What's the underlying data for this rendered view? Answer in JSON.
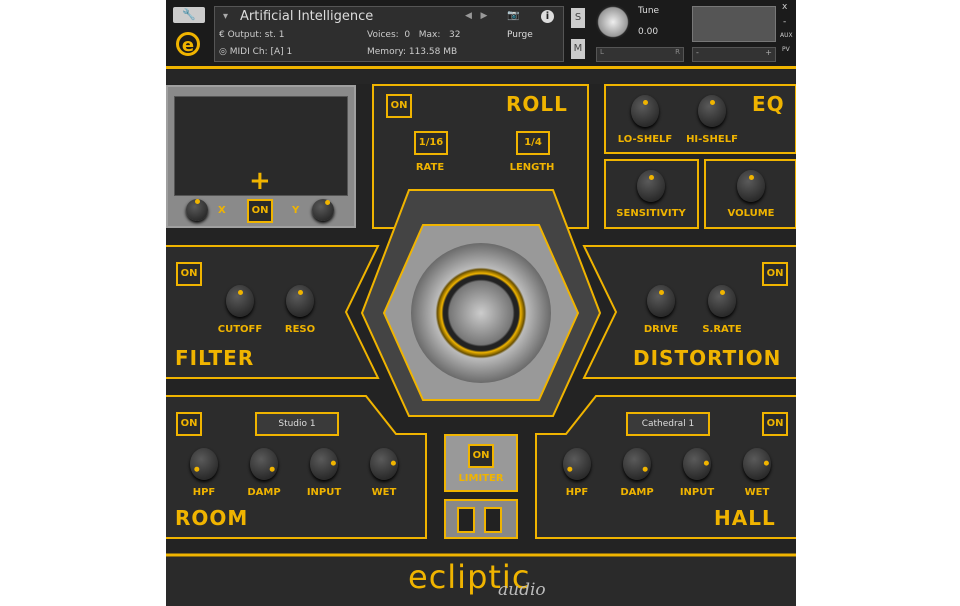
{
  "header": {
    "instrument_name": "Artificial Intelligence",
    "output_label": "Output:",
    "output_value": "st. 1",
    "midi_label": "MIDI Ch:",
    "midi_value": "[A] 1",
    "voices_label": "Voices:",
    "voices_value": "0",
    "max_label": "Max:",
    "max_value": "32",
    "memory_label": "Memory:",
    "memory_value": "113.58 MB",
    "purge_label": "Purge",
    "solo_label": "S",
    "mute_label": "M",
    "tune_label": "Tune",
    "tune_value": "0.00",
    "pan_left": "L",
    "pan_right": "R",
    "vol_minus": "-",
    "vol_plus": "+",
    "close_label": "x",
    "minimize_label": "-",
    "aux_label": "AUX",
    "pv_label": "PV"
  },
  "xy": {
    "on_label": "ON",
    "x_label": "X",
    "y_label": "Y",
    "x_knob": 0.5,
    "y_knob": 0.6
  },
  "roll": {
    "title": "ROLL",
    "on_label": "ON",
    "rate_value": "1/16",
    "rate_label": "RATE",
    "length_value": "1/4",
    "length_label": "LENGTH"
  },
  "eq": {
    "title": "EQ",
    "lo_label": "LO-SHELF",
    "hi_label": "HI-SHELF",
    "lo": 0.5,
    "hi": 0.5
  },
  "sensitivity": {
    "label": "SENSITIVITY",
    "value": 0.5
  },
  "volume": {
    "label": "VOLUME",
    "value": 0.5
  },
  "filter": {
    "title": "FILTER",
    "on_label": "ON",
    "cutoff_label": "CUTOFF",
    "reso_label": "RESO",
    "cutoff": 0.5,
    "reso": 0.5
  },
  "distortion": {
    "title": "DISTORTION",
    "on_label": "ON",
    "drive_label": "DRIVE",
    "srate_label": "S.RATE",
    "drive": 0.5,
    "srate": 0.5
  },
  "room": {
    "title": "ROOM",
    "on_label": "ON",
    "preset": "Studio 1",
    "labels": [
      "HPF",
      "DAMP",
      "INPUT",
      "WET"
    ],
    "values": [
      0.05,
      0.95,
      0.8,
      0.8
    ]
  },
  "hall": {
    "title": "HALL",
    "on_label": "ON",
    "preset": "Cathedral 1",
    "labels": [
      "HPF",
      "DAMP",
      "INPUT",
      "WET"
    ],
    "values": [
      0.05,
      0.95,
      0.8,
      0.8
    ]
  },
  "limiter": {
    "on_label": "ON",
    "label": "LIMITER"
  },
  "footer": {
    "logo": "ecliptic",
    "logo_sub": "audio"
  },
  "colors": {
    "accent": "#f0b400",
    "panel": "#2a2a2a"
  }
}
